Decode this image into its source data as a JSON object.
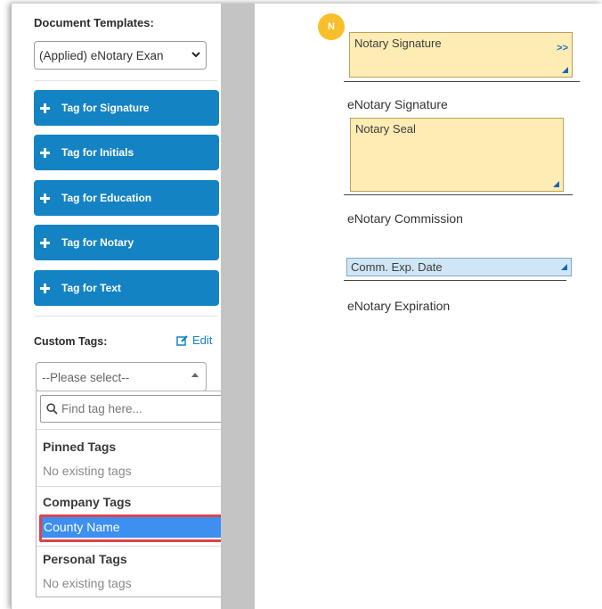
{
  "sidebar": {
    "templates_label": "Document Templates:",
    "template_selected": "(Applied) eNotary Exan",
    "tag_buttons": [
      {
        "label": "Tag for Signature"
      },
      {
        "label": "Tag for Initials"
      },
      {
        "label": "Tag for Education"
      },
      {
        "label": "Tag for Notary"
      },
      {
        "label": "Tag for Text"
      }
    ],
    "custom_tags_label": "Custom Tags:",
    "edit_label": "Edit",
    "custom_select_placeholder": "--Please select--",
    "dropdown": {
      "search_placeholder": "Find tag here...",
      "groups": [
        {
          "title": "Pinned Tags",
          "empty": "No existing tags"
        },
        {
          "title": "Company Tags",
          "item": "County Name"
        },
        {
          "title": "Personal Tags",
          "empty": "No existing tags"
        }
      ]
    }
  },
  "document": {
    "badge_letter": "N",
    "notary_signature_field": "Notary Signature",
    "expand_arrows": ">>",
    "signature_caption": "eNotary Signature",
    "notary_seal_field": "Notary Seal",
    "commission_caption": "eNotary Commission",
    "comm_exp_field": "Comm. Exp. Date",
    "expiration_caption": "eNotary Expiration"
  },
  "colors": {
    "button_blue": "#1483c4",
    "field_yellow": "#fdecb3",
    "field_blue": "#cfe6f6",
    "highlight_blue": "#3d8ff0",
    "outline_red": "#e0414a",
    "badge_yellow": "#f7c02a"
  }
}
